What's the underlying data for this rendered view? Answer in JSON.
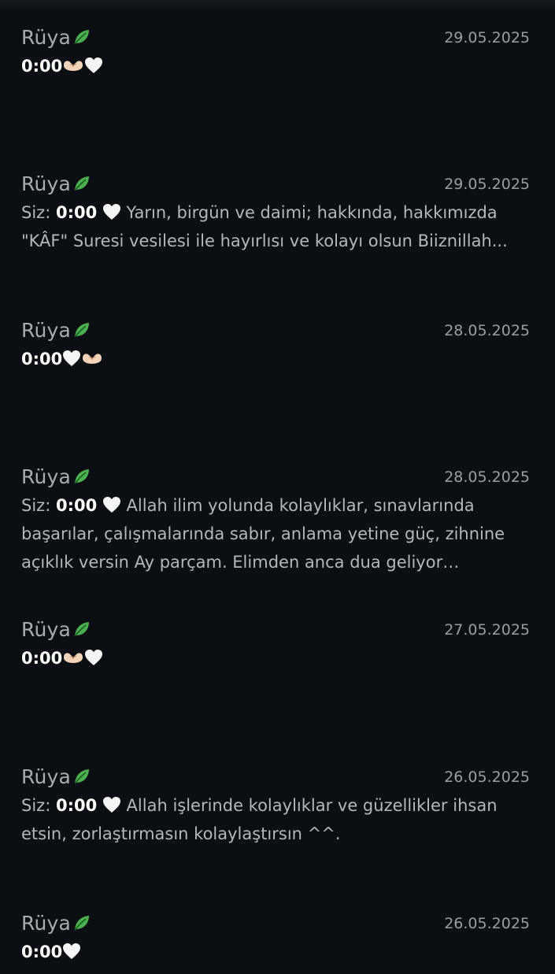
{
  "notifications": [
    {
      "sender": "Rüya",
      "date": "29.05.2025",
      "prefix": "",
      "strong": "0:00",
      "emojis": [
        "hands-heart-icon",
        "white-heart-icon"
      ],
      "text": ""
    },
    {
      "sender": "Rüya",
      "date": "29.05.2025",
      "prefix": "Siz: ",
      "strong": "0:00",
      "emojis": [
        "white-heart-icon"
      ],
      "text": "  Yarın, birgün ve daimi; hakkında, hakkımızda \"KÂF\" Suresi vesilesi ile hayırlısı ve kolayı olsun Biiznillah..."
    },
    {
      "sender": "Rüya",
      "date": "28.05.2025",
      "prefix": "",
      "strong": "0:00",
      "emojis": [
        "white-heart-icon",
        "hands-heart-icon"
      ],
      "text": ""
    },
    {
      "sender": "Rüya",
      "date": "28.05.2025",
      "prefix": "Siz: ",
      "strong": "0:00",
      "emojis": [
        "white-heart-icon"
      ],
      "text": " Allah ilim yolunda kolaylıklar, sınavlarında başarılar, çalışmalarında sabır, anlama yetine güç, zihnine açıklık versin Ay parçam. Elimden anca dua geliyor şimdilik,..."
    },
    {
      "sender": "Rüya",
      "date": "27.05.2025",
      "prefix": "",
      "strong": "0:00",
      "emojis": [
        "hands-heart-icon",
        "white-heart-icon"
      ],
      "text": ""
    },
    {
      "sender": "Rüya",
      "date": "26.05.2025",
      "prefix": "Siz: ",
      "strong": "0:00",
      "emojis": [
        "white-heart-icon"
      ],
      "text": " Allah işlerinde kolaylıklar ve güzellikler ihsan etsin, zorlaştırmasın kolaylaştırsın ^^."
    },
    {
      "sender": "Rüya",
      "date": "26.05.2025",
      "prefix": "",
      "strong": "0:00",
      "emojis": [
        "white-heart-icon"
      ],
      "text": ""
    }
  ],
  "colors": {
    "background": "#0b0f13",
    "sender": "#a9adb1",
    "date": "#9a9ea3",
    "body": "#b4b8bc",
    "strong": "#ffffff",
    "leaf": "#4caf50"
  }
}
